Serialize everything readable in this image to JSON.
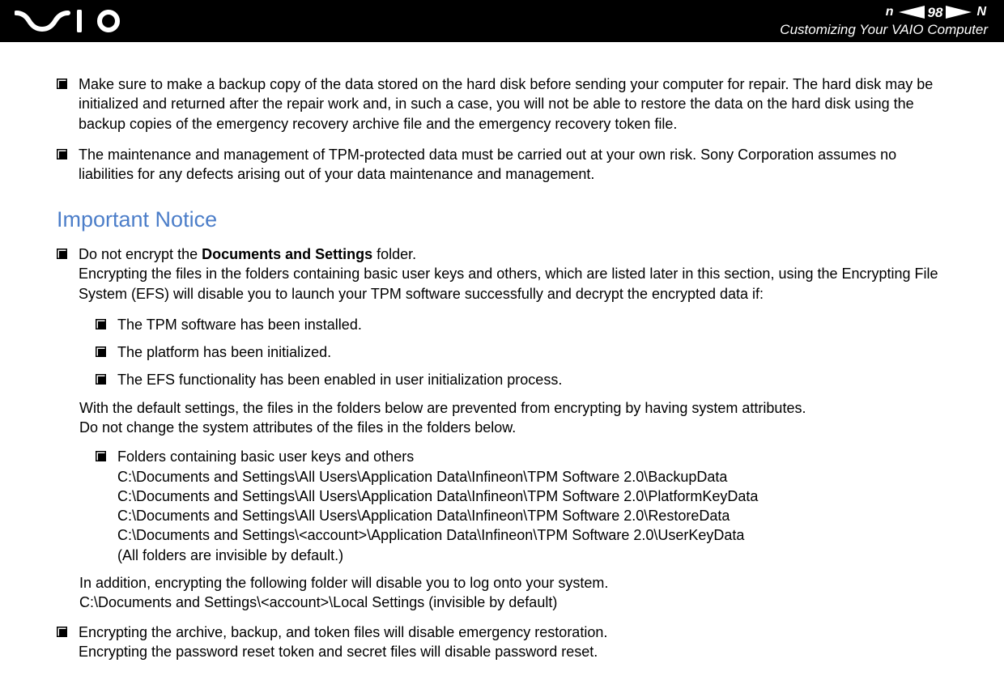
{
  "header": {
    "page_number": "98",
    "n_label": "n",
    "N_label": "N",
    "subtitle": "Customizing Your VAIO Computer"
  },
  "bullets_top": [
    "Make sure to make a backup copy of the data stored on the hard disk before sending your computer for repair. The hard disk may be initialized and returned after the repair work and, in such a case, you will not be able to restore the data on the hard disk using the backup copies of the emergency recovery archive file and the emergency recovery token file.",
    "The maintenance and management of TPM-protected data must be carried out at your own risk. Sony Corporation assumes no liabilities for any defects arising out of your data maintenance and management."
  ],
  "notice_heading": "Important Notice",
  "notice_b1_prefix": "Do not encrypt the ",
  "notice_b1_bold": "Documents and Settings",
  "notice_b1_suffix": " folder.",
  "notice_b1_para": "Encrypting the files in the folders containing basic user keys and others, which are listed later in this section, using the Encrypting File System (EFS) will disable you to launch your TPM software successfully and decrypt the encrypted data if:",
  "sub_bullets_1": [
    "The TPM software has been installed.",
    "The platform has been initialized.",
    "The EFS functionality has been enabled in user initialization process."
  ],
  "after_sub1_l1": "With the default settings, the files in the folders below are prevented from encrypting by having system attributes.",
  "after_sub1_l2": "Do not change the system attributes of the files in the folders below.",
  "sub_bullets_2_title": "Folders containing basic user keys and others",
  "sub_bullets_2_lines": [
    "C:\\Documents and Settings\\All Users\\Application Data\\Infineon\\TPM Software 2.0\\BackupData",
    "C:\\Documents and Settings\\All Users\\Application Data\\Infineon\\TPM Software 2.0\\PlatformKeyData",
    "C:\\Documents and Settings\\All Users\\Application Data\\Infineon\\TPM Software 2.0\\RestoreData",
    "C:\\Documents and Settings\\<account>\\Application Data\\Infineon\\TPM Software 2.0\\UserKeyData",
    "(All folders are invisible by default.)"
  ],
  "after_sub2_l1": "In addition, encrypting the following folder will disable you to log onto your system.",
  "after_sub2_l2": "C:\\Documents and Settings\\<account>\\Local Settings (invisible by default)",
  "notice_b2_l1": "Encrypting the archive, backup, and token files will disable emergency restoration.",
  "notice_b2_l2": "Encrypting the password reset token and secret files will disable password reset."
}
